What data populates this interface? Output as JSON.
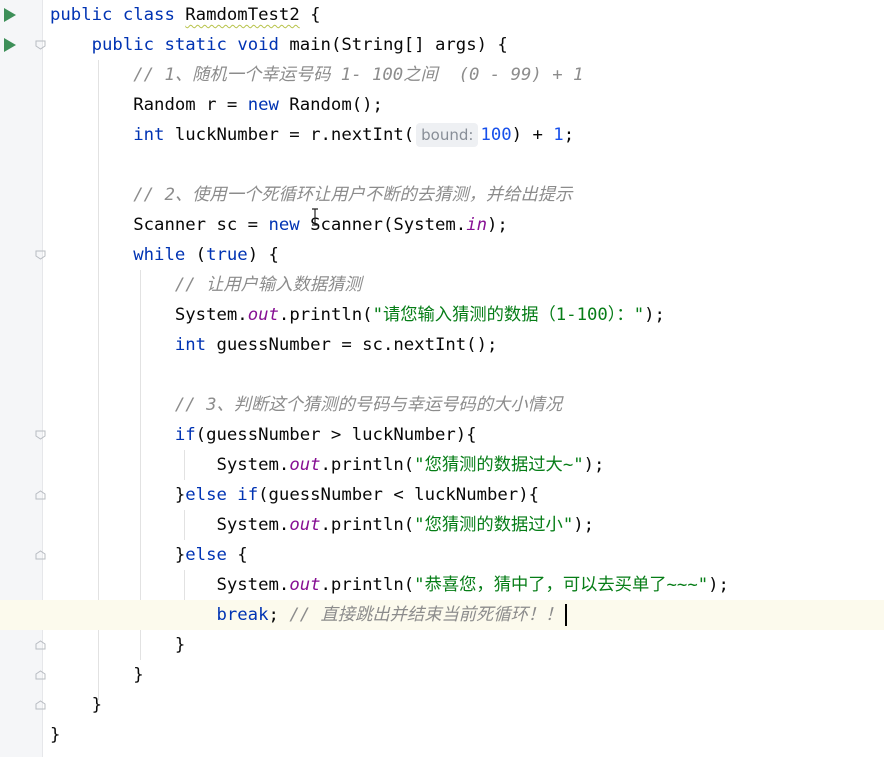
{
  "editor": {
    "lines": [
      {
        "kind": "class_decl",
        "kw_public": "public",
        "kw_class": "class",
        "name": "RamdomTest2",
        "brace": " {"
      },
      {
        "kind": "method_decl",
        "kw_public": "public",
        "kw_static": "static",
        "kw_void": "void",
        "rest": "main(String[] args) {"
      },
      {
        "kind": "comment",
        "text": "// 1、随机一个幸运号码 1- 100之间  (0 - 99) + 1"
      },
      {
        "kind": "random_decl",
        "type": "Random r = ",
        "kw_new": "new",
        "rest": " Random();"
      },
      {
        "kind": "luck_decl",
        "kw_int": "int",
        "mid": " luckNumber = r.nextInt(",
        "hint": "bound:",
        "num1": "100",
        "mid2": ") + ",
        "num2": "1",
        "end": ";"
      },
      {
        "kind": "empty"
      },
      {
        "kind": "comment",
        "text": "// 2、使用一个死循环让用户不断的去猜测，并给出提示"
      },
      {
        "kind": "scanner_decl",
        "type": "Scanner sc = ",
        "kw_new": "new",
        "mid": " Scanner(System.",
        "field": "in",
        "end": ");"
      },
      {
        "kind": "while",
        "kw_while": "while",
        "mid": " (",
        "kw_true": "true",
        "end": ") {"
      },
      {
        "kind": "comment",
        "text": "// 让用户输入数据猜测"
      },
      {
        "kind": "println",
        "pre": "System.",
        "field": "out",
        "mid": ".println(",
        "str": "\"请您输入猜测的数据（1-100）：\"",
        "end": ");"
      },
      {
        "kind": "guess_decl",
        "kw_int": "int",
        "rest": " guessNumber = sc.nextInt();"
      },
      {
        "kind": "empty"
      },
      {
        "kind": "comment",
        "text": "// 3、判断这个猜测的号码与幸运号码的大小情况"
      },
      {
        "kind": "if",
        "kw_if": "if",
        "rest": "(guessNumber > luckNumber){"
      },
      {
        "kind": "println",
        "pre": "System.",
        "field": "out",
        "mid": ".println(",
        "str": "\"您猜测的数据过大~\"",
        "end": ");"
      },
      {
        "kind": "elseif",
        "pre": "}",
        "kw_else": "else",
        "sp": " ",
        "kw_if": "if",
        "rest": "(guessNumber < luckNumber){"
      },
      {
        "kind": "println",
        "pre": "System.",
        "field": "out",
        "mid": ".println(",
        "str": "\"您猜测的数据过小\"",
        "end": ");"
      },
      {
        "kind": "else",
        "pre": "}",
        "kw_else": "else",
        "rest": " {"
      },
      {
        "kind": "println",
        "pre": "System.",
        "field": "out",
        "mid": ".println(",
        "str": "\"恭喜您，猜中了，可以去买单了~~~\"",
        "end": ");"
      },
      {
        "kind": "break",
        "kw_break": "break",
        "semi": "; ",
        "comment": "// 直接跳出并结束当前死循环！！"
      },
      {
        "kind": "brace",
        "text": "}"
      },
      {
        "kind": "brace",
        "text": "}"
      },
      {
        "kind": "brace",
        "text": "}"
      },
      {
        "kind": "brace",
        "text": "}"
      }
    ]
  },
  "icons": {
    "run": "run-triangle-icon",
    "fold": "fold-marker-icon"
  },
  "colors": {
    "keyword": "#0033b3",
    "number": "#1750eb",
    "string": "#067d17",
    "comment": "#8c8c8c",
    "field": "#871094",
    "current_line": "#fcfaed"
  }
}
